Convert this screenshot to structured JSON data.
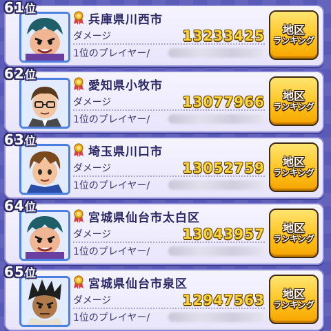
{
  "colors": {
    "background": "#5a5ab8",
    "card": "#eeebfd",
    "damage_value": "#ffd53a",
    "button": "#ffc21a",
    "avatar_border": "#4c7fe0",
    "medal": "#d94040"
  },
  "labels": {
    "damage": "ダメージ",
    "top_player": "1位のプレイヤー/",
    "rank_suffix": "位",
    "button_top": "地区",
    "button_bottom": "ランキング"
  },
  "rows": [
    {
      "rank": "61",
      "region": "兵庫県川西市",
      "damage": "13233425",
      "avatar_icon": "yokai-character-icon"
    },
    {
      "rank": "62",
      "region": "愛知県小牧市",
      "damage": "13077966",
      "avatar_icon": "glasses-character-icon"
    },
    {
      "rank": "63",
      "region": "埼玉県川口市",
      "damage": "13052759",
      "avatar_icon": "boy-character-icon"
    },
    {
      "rank": "64",
      "region": "宮城県仙台市太白区",
      "damage": "13043957",
      "avatar_icon": "yokai-character-icon"
    },
    {
      "rank": "65",
      "region": "宮城県仙台市泉区",
      "damage": "12947563",
      "avatar_icon": "tan-boy-character-icon"
    }
  ]
}
